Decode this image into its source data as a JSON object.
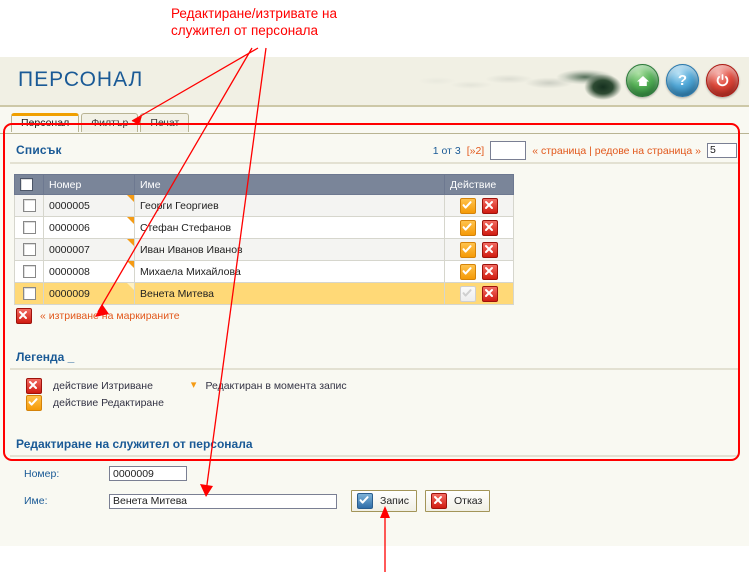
{
  "annotations": {
    "top_note": "Редактиране/изтривате на\nслужител от персонала"
  },
  "header": {
    "title": "ПЕРСОНАЛ",
    "buttons": [
      {
        "name": "home-button",
        "icon": "home-icon",
        "color": "#1d7a33"
      },
      {
        "name": "help-button",
        "icon": "question-icon",
        "color": "#1a6fa5"
      },
      {
        "name": "power-button",
        "icon": "power-icon",
        "color": "#ad1a12"
      }
    ]
  },
  "tabs": [
    {
      "label": "Персонал",
      "active": true
    },
    {
      "label": "Филтър",
      "active": false
    },
    {
      "label": "Печат",
      "active": false
    }
  ],
  "list_section": {
    "title": "Списък",
    "pager": {
      "current": "1 от 3",
      "next": "[»2]",
      "page_input_value": "",
      "links": "« страница | редове на страница »",
      "rows_per_page": "5"
    },
    "columns": [
      "",
      "Номер",
      "Име",
      "Действие"
    ],
    "rows": [
      {
        "number": "0000005",
        "name": "Георги Георгиев",
        "flagged": true,
        "selected": false,
        "edit_enabled": true
      },
      {
        "number": "0000006",
        "name": "Стефан Стефанов",
        "flagged": true,
        "selected": false,
        "edit_enabled": true
      },
      {
        "number": "0000007",
        "name": "Иван Иванов Иванов",
        "flagged": true,
        "selected": false,
        "edit_enabled": true
      },
      {
        "number": "0000008",
        "name": "Михаела Михайлова",
        "flagged": true,
        "selected": false,
        "edit_enabled": true
      },
      {
        "number": "0000009",
        "name": "Венета Митева",
        "flagged": true,
        "selected": true,
        "edit_enabled": false
      }
    ],
    "delete_marked": "« изтриване на маркираните"
  },
  "legend": {
    "title": "Легенда _",
    "items": [
      {
        "icon": "delete-icon",
        "label": "действие Изтриване"
      },
      {
        "icon": "edit-icon",
        "label": "действие Редактиране"
      }
    ],
    "note_icon": "chevron-marker-icon",
    "note": "Редактиран в момента запис"
  },
  "form": {
    "title": "Редактиране на служител от персонала",
    "fields": [
      {
        "label": "Номер:",
        "value": "0000009"
      },
      {
        "label": "Име:",
        "value": "Венета Митева"
      }
    ],
    "save_label": "Запис",
    "cancel_label": "Отказ"
  },
  "colors": {
    "accent_blue": "#1a5a96",
    "accent_orange": "#e2581b",
    "annotation_red": "#ff0000",
    "selected_row": "#ffd977",
    "header_row": "#7a8599"
  }
}
